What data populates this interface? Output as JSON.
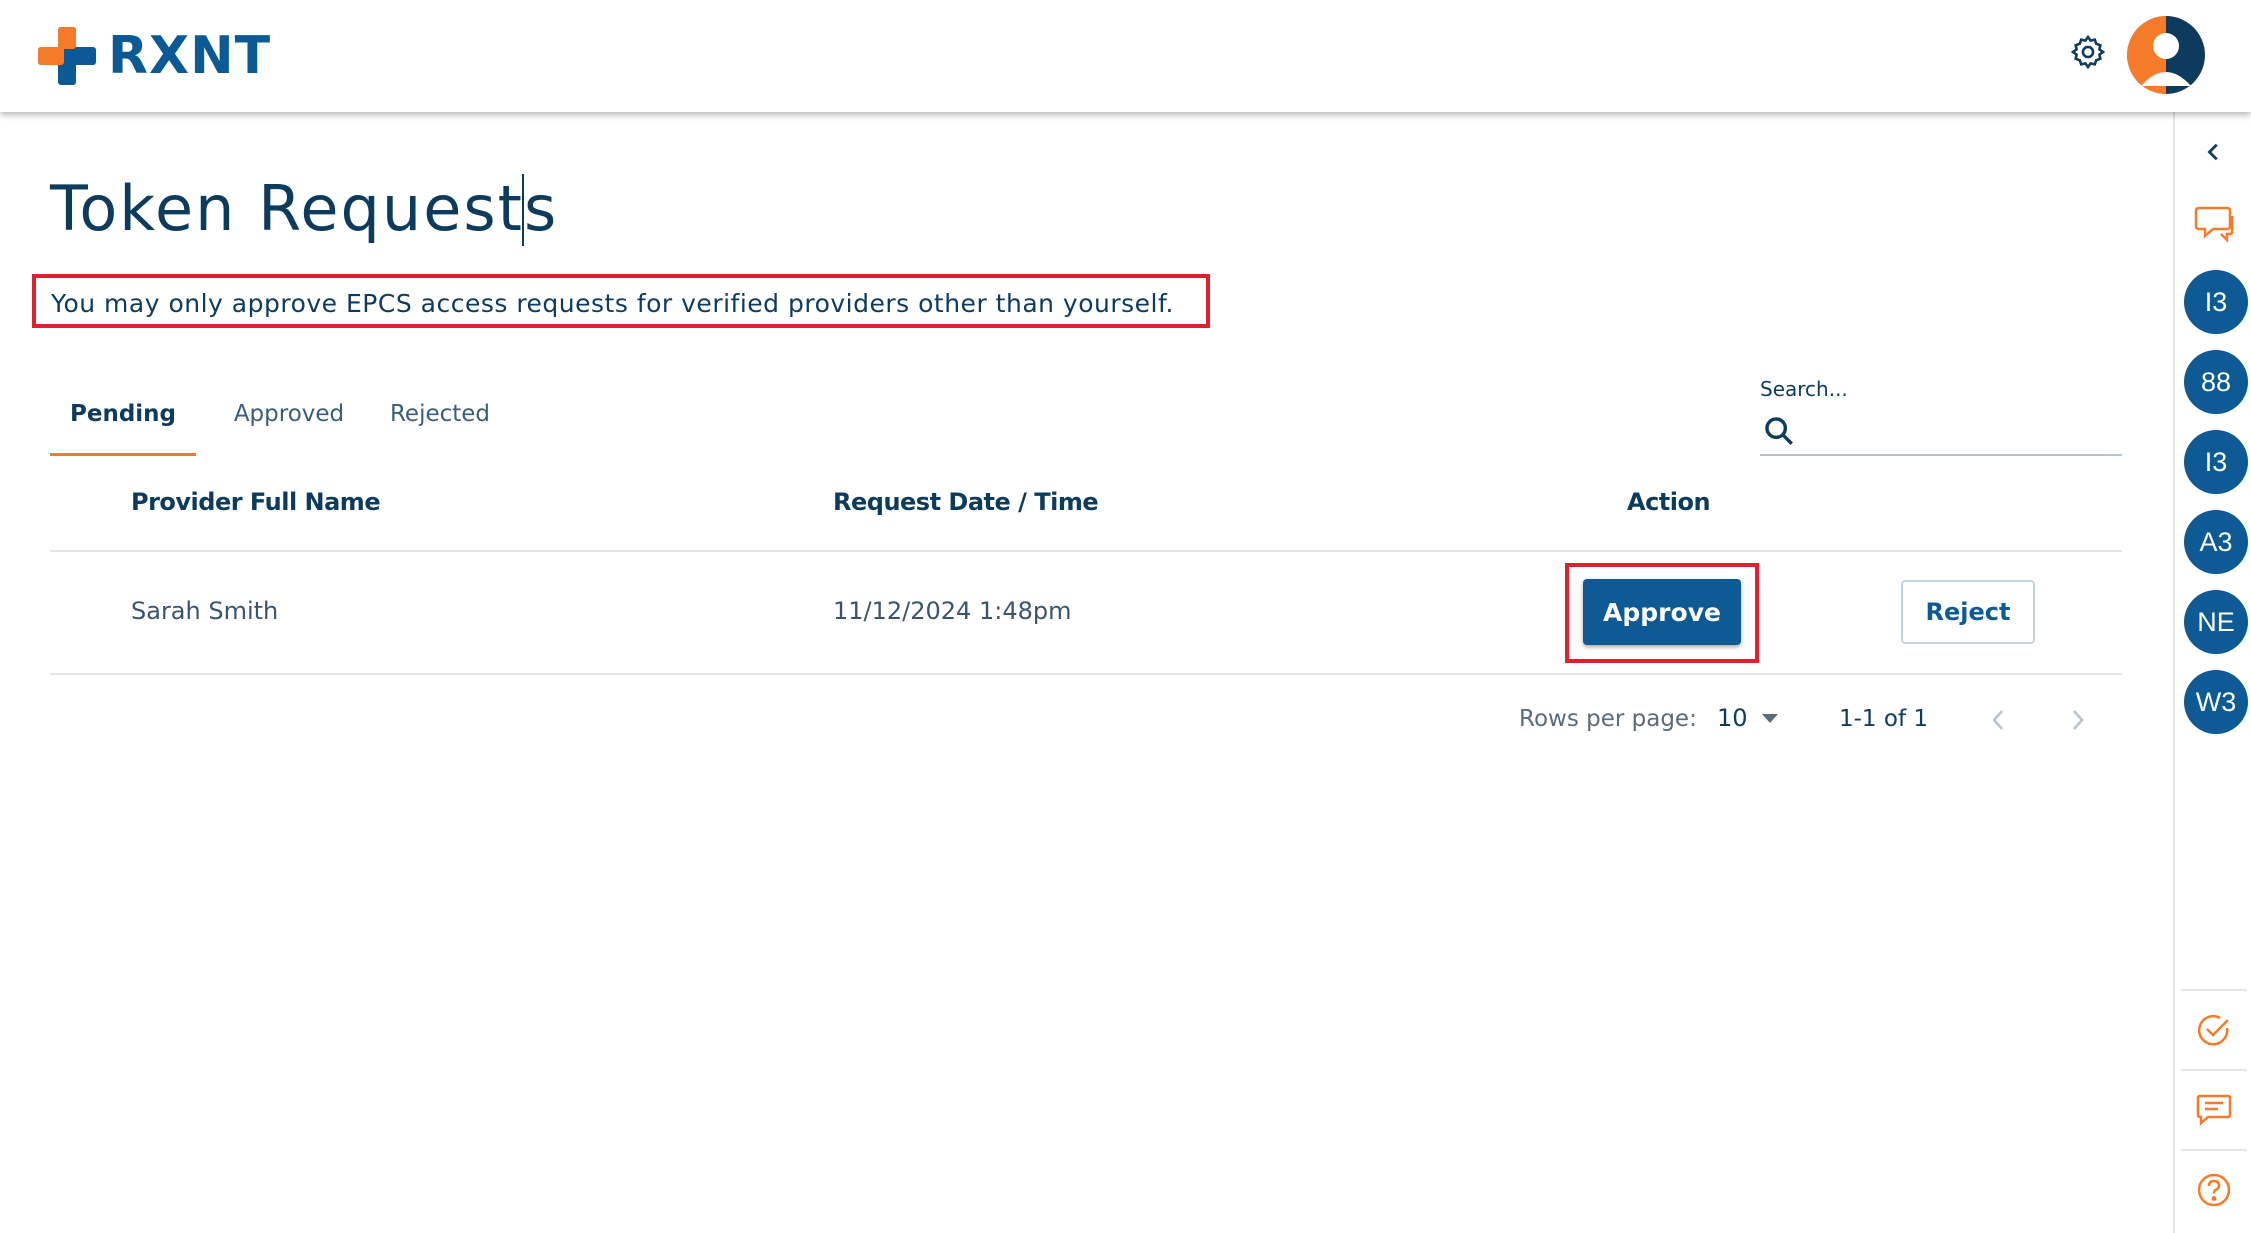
{
  "header": {
    "logo_text": "RXNT",
    "brand_colors": {
      "orange": "#f47b2a",
      "blue": "#0c5a95"
    }
  },
  "page": {
    "title": "Token Requests",
    "notice": "You may only approve EPCS access requests for verified providers other than yourself."
  },
  "tabs": [
    {
      "label": "Pending",
      "active": true
    },
    {
      "label": "Approved",
      "active": false
    },
    {
      "label": "Rejected",
      "active": false
    }
  ],
  "search": {
    "label": "Search...",
    "value": ""
  },
  "table": {
    "columns": [
      "Provider Full Name",
      "Request Date / Time",
      "Action"
    ],
    "rows": [
      {
        "provider": "Sarah Smith",
        "datetime": "11/12/2024 1:48pm",
        "approve_label": "Approve",
        "reject_label": "Reject"
      }
    ]
  },
  "pagination": {
    "rows_per_page_label": "Rows per page:",
    "rows_per_page": "10",
    "range": "1-1 of 1"
  },
  "sidebar": {
    "circles": [
      "I3",
      "88",
      "I3",
      "A3",
      "NE",
      "W3"
    ],
    "icons": [
      "chevron-left-icon",
      "chat-bubbles-icon",
      "check-circle-icon",
      "message-icon",
      "help-icon"
    ]
  },
  "colors": {
    "highlight": "#e0202e",
    "primary": "#0d5a94",
    "accent": "#f47b2a"
  }
}
